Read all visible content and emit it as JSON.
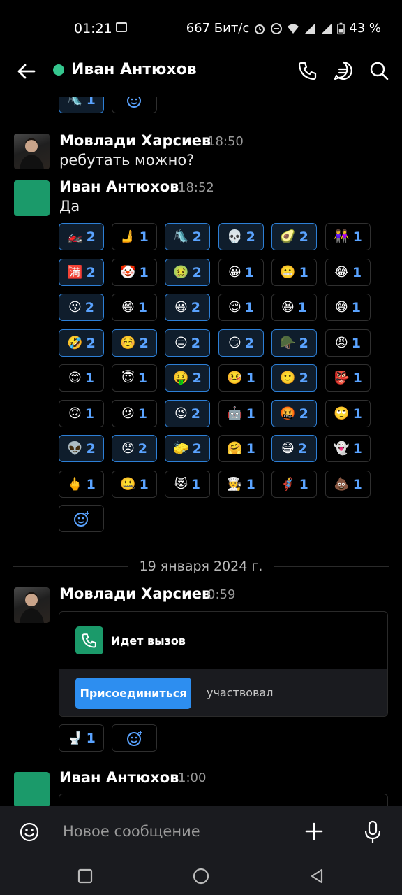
{
  "status_bar": {
    "time": "01:21",
    "net_speed": "667 Бит/с",
    "battery": "43 %"
  },
  "header": {
    "title": "Иван Антюхов",
    "online_color": "#35c68e"
  },
  "messages": [
    {
      "author": "Мовлади Харсиев",
      "time": "18:50",
      "text": "ребутать можно?"
    },
    {
      "author": "Иван Антюхов",
      "time": "18:52",
      "text": "Да"
    },
    {
      "author": "Мовлади Харсиев",
      "time": "0:59"
    },
    {
      "author": "Иван Антюхов",
      "time": "1:00"
    }
  ],
  "top_partial_reaction": {
    "emoji": "🛝",
    "count": "1"
  },
  "reactions": [
    {
      "emoji": "🏍️",
      "count": "2",
      "active": true
    },
    {
      "emoji": "🫸",
      "count": "1",
      "active": false
    },
    {
      "emoji": "🛝",
      "count": "2",
      "active": true
    },
    {
      "emoji": "💀",
      "count": "2",
      "active": true
    },
    {
      "emoji": "🥑",
      "count": "2",
      "active": true
    },
    {
      "emoji": "👭",
      "count": "1",
      "active": false
    },
    {
      "emoji": "🈵",
      "count": "2",
      "active": true
    },
    {
      "emoji": "🤡",
      "count": "1",
      "active": false
    },
    {
      "emoji": "🤢",
      "count": "2",
      "active": true
    },
    {
      "emoji": "😀",
      "count": "1",
      "active": false
    },
    {
      "emoji": "😬",
      "count": "1",
      "active": false
    },
    {
      "emoji": "😂",
      "count": "1",
      "active": false
    },
    {
      "emoji": "😗",
      "count": "2",
      "active": true
    },
    {
      "emoji": "😄",
      "count": "1",
      "active": false
    },
    {
      "emoji": "😃",
      "count": "2",
      "active": true
    },
    {
      "emoji": "😌",
      "count": "1",
      "active": false
    },
    {
      "emoji": "😆",
      "count": "1",
      "active": false
    },
    {
      "emoji": "😅",
      "count": "1",
      "active": false
    },
    {
      "emoji": "🤣",
      "count": "2",
      "active": true
    },
    {
      "emoji": "☺️",
      "count": "2",
      "active": true
    },
    {
      "emoji": "😑",
      "count": "2",
      "active": true
    },
    {
      "emoji": "😏",
      "count": "2",
      "active": true
    },
    {
      "emoji": "🪖",
      "count": "2",
      "active": true
    },
    {
      "emoji": "😡",
      "count": "1",
      "active": false
    },
    {
      "emoji": "😊",
      "count": "1",
      "active": false
    },
    {
      "emoji": "😇",
      "count": "1",
      "active": false
    },
    {
      "emoji": "🤑",
      "count": "2",
      "active": true
    },
    {
      "emoji": "🤒",
      "count": "1",
      "active": false
    },
    {
      "emoji": "🙂",
      "count": "2",
      "active": true
    },
    {
      "emoji": "👺",
      "count": "1",
      "active": false
    },
    {
      "emoji": "🙃",
      "count": "1",
      "active": false
    },
    {
      "emoji": "😕",
      "count": "1",
      "active": false
    },
    {
      "emoji": "😉",
      "count": "2",
      "active": true
    },
    {
      "emoji": "🤖",
      "count": "1",
      "active": false
    },
    {
      "emoji": "🤬",
      "count": "2",
      "active": true
    },
    {
      "emoji": "🙄",
      "count": "1",
      "active": false
    },
    {
      "emoji": "👽",
      "count": "2",
      "active": true
    },
    {
      "emoji": "😞",
      "count": "2",
      "active": true
    },
    {
      "emoji": "🧽",
      "count": "2",
      "active": true
    },
    {
      "emoji": "🤗",
      "count": "1",
      "active": false
    },
    {
      "emoji": "😷",
      "count": "2",
      "active": true
    },
    {
      "emoji": "👻",
      "count": "1",
      "active": false
    },
    {
      "emoji": "🖕",
      "count": "1",
      "active": false
    },
    {
      "emoji": "🤐",
      "count": "1",
      "active": false
    },
    {
      "emoji": "😻",
      "count": "1",
      "active": false
    },
    {
      "emoji": "🧑‍🍳",
      "count": "1",
      "active": false
    },
    {
      "emoji": "🦸",
      "count": "1",
      "active": false
    },
    {
      "emoji": "💩",
      "count": "1",
      "active": false
    }
  ],
  "date_separator": "19 января 2024 г.",
  "call": {
    "title": "Идет вызов",
    "join_label": "Присоединиться",
    "status": "участвовал"
  },
  "call_reaction": {
    "emoji": "🚽",
    "count": "1"
  },
  "composer": {
    "placeholder": "Новое сообщение"
  },
  "icons": {
    "back": "arrow-left-icon",
    "call": "phone-icon",
    "threads": "chat-bubble-icon",
    "search": "search-icon",
    "add_reaction": "add-emoji-icon",
    "emoji": "smiley-icon",
    "attach": "plus-icon",
    "mic": "microphone-icon"
  }
}
